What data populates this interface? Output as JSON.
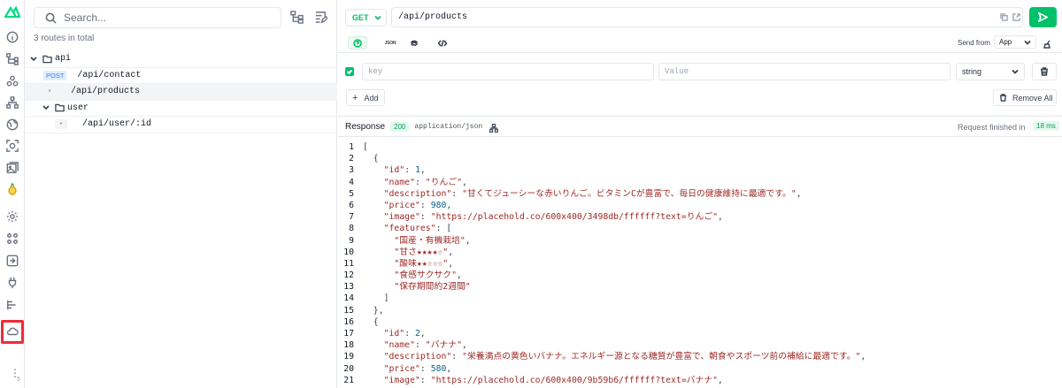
{
  "sidebar": {
    "icons": [
      "logo-icon",
      "info-icon",
      "routes-icon",
      "components-icon",
      "tree-icon",
      "globe-icon",
      "inspect-icon",
      "assets-icon",
      "pinia-icon",
      "settings-icon",
      "modules-icon",
      "imports-icon",
      "hooks-icon",
      "timeline-icon",
      "server-routes-icon"
    ],
    "more_label": "⋮",
    "more_sub": "5"
  },
  "routes": {
    "search_placeholder": "Search...",
    "total": "3 routes in total",
    "tree": [
      {
        "kind": "folder",
        "label": "api"
      },
      {
        "kind": "route",
        "method": "POST",
        "path": "/api/contact"
      },
      {
        "kind": "route",
        "method": "*",
        "path": "/api/products"
      },
      {
        "kind": "folder",
        "label": "user"
      },
      {
        "kind": "route",
        "method": "*",
        "path": "/api/user/:id"
      }
    ]
  },
  "request": {
    "method": "GET",
    "url": "/api/products",
    "tab_json_label": "JSON",
    "send_from_label": "Send from",
    "send_from_value": "App"
  },
  "params": {
    "key_placeholder": "key",
    "value_placeholder": "Value",
    "type": "string",
    "add_label": "Add",
    "remove_all_label": "Remove All"
  },
  "response": {
    "title": "Response",
    "status": "200",
    "content_type": "application/json",
    "finished_label": "Request finished in",
    "time": "18 ms",
    "lines": [
      "[",
      "  {",
      "    \"id\": 1,",
      "    \"name\": \"りんご\",",
      "    \"description\": \"甘くてジューシーな赤いりんご。ビタミンCが豊富で、毎日の健康維持に最適です。\",",
      "    \"price\": 980,",
      "    \"image\": \"https://placehold.co/600x400/3498db/ffffff?text=りんご\",",
      "    \"features\": [",
      "      \"国産・有機栽培\",",
      "      \"甘さ★★★★☆\",",
      "      \"酸味★★☆☆☆\",",
      "      \"食感サクサク\",",
      "      \"保存期間約2週間\"",
      "    ]",
      "  },",
      "  {",
      "    \"id\": 2,",
      "    \"name\": \"バナナ\",",
      "    \"description\": \"栄養満点の黄色いバナナ。エネルギー源となる糖質が豊富で、朝食やスポーツ前の補給に最適です。\",",
      "    \"price\": 580,",
      "    \"image\": \"https://placehold.co/600x400/9b59b6/ffffff?text=バナナ\","
    ]
  },
  "colors": {
    "accent": "#00c16a",
    "highlight": "#ef2b3a",
    "string": "#9c2a25",
    "number": "#0a5e8a"
  }
}
